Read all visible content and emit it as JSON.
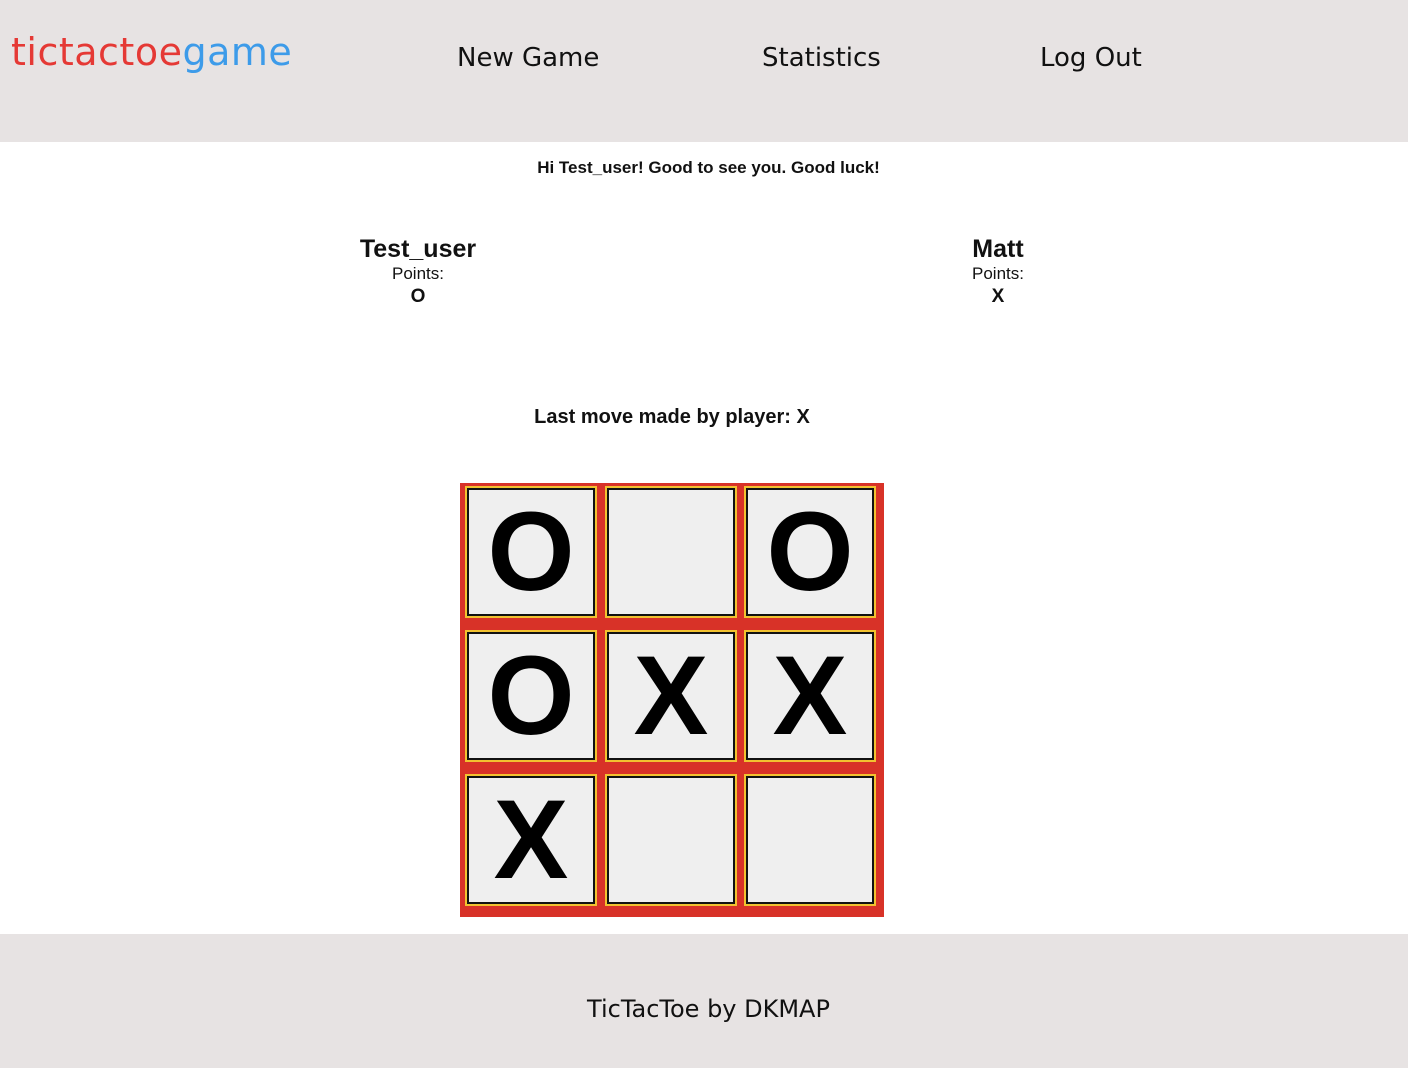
{
  "header": {
    "logo": {
      "part_a": "tictactoe",
      "part_b": "game"
    },
    "nav": {
      "new_game": "New Game",
      "statistics": "Statistics",
      "log_out": "Log Out"
    }
  },
  "greeting": "Hi Test_user! Good to see you. Good luck!",
  "players": [
    {
      "name": "Test_user",
      "points_label": "Points:",
      "symbol": "O"
    },
    {
      "name": "Matt",
      "points_label": "Points:",
      "symbol": "X"
    }
  ],
  "last_move": "Last move made by player: X",
  "board": {
    "cells": [
      "O",
      "",
      "O",
      "O",
      "X",
      "X",
      "X",
      "",
      ""
    ]
  },
  "footer": {
    "text": "TicTacToe by DKMAP"
  },
  "colors": {
    "logo_red": "#e53935",
    "logo_blue": "#3d9be9",
    "header_bg": "#e7e3e3",
    "board_red": "#d83228",
    "cell_outline": "#f2c230",
    "cell_bg": "#efefef"
  }
}
